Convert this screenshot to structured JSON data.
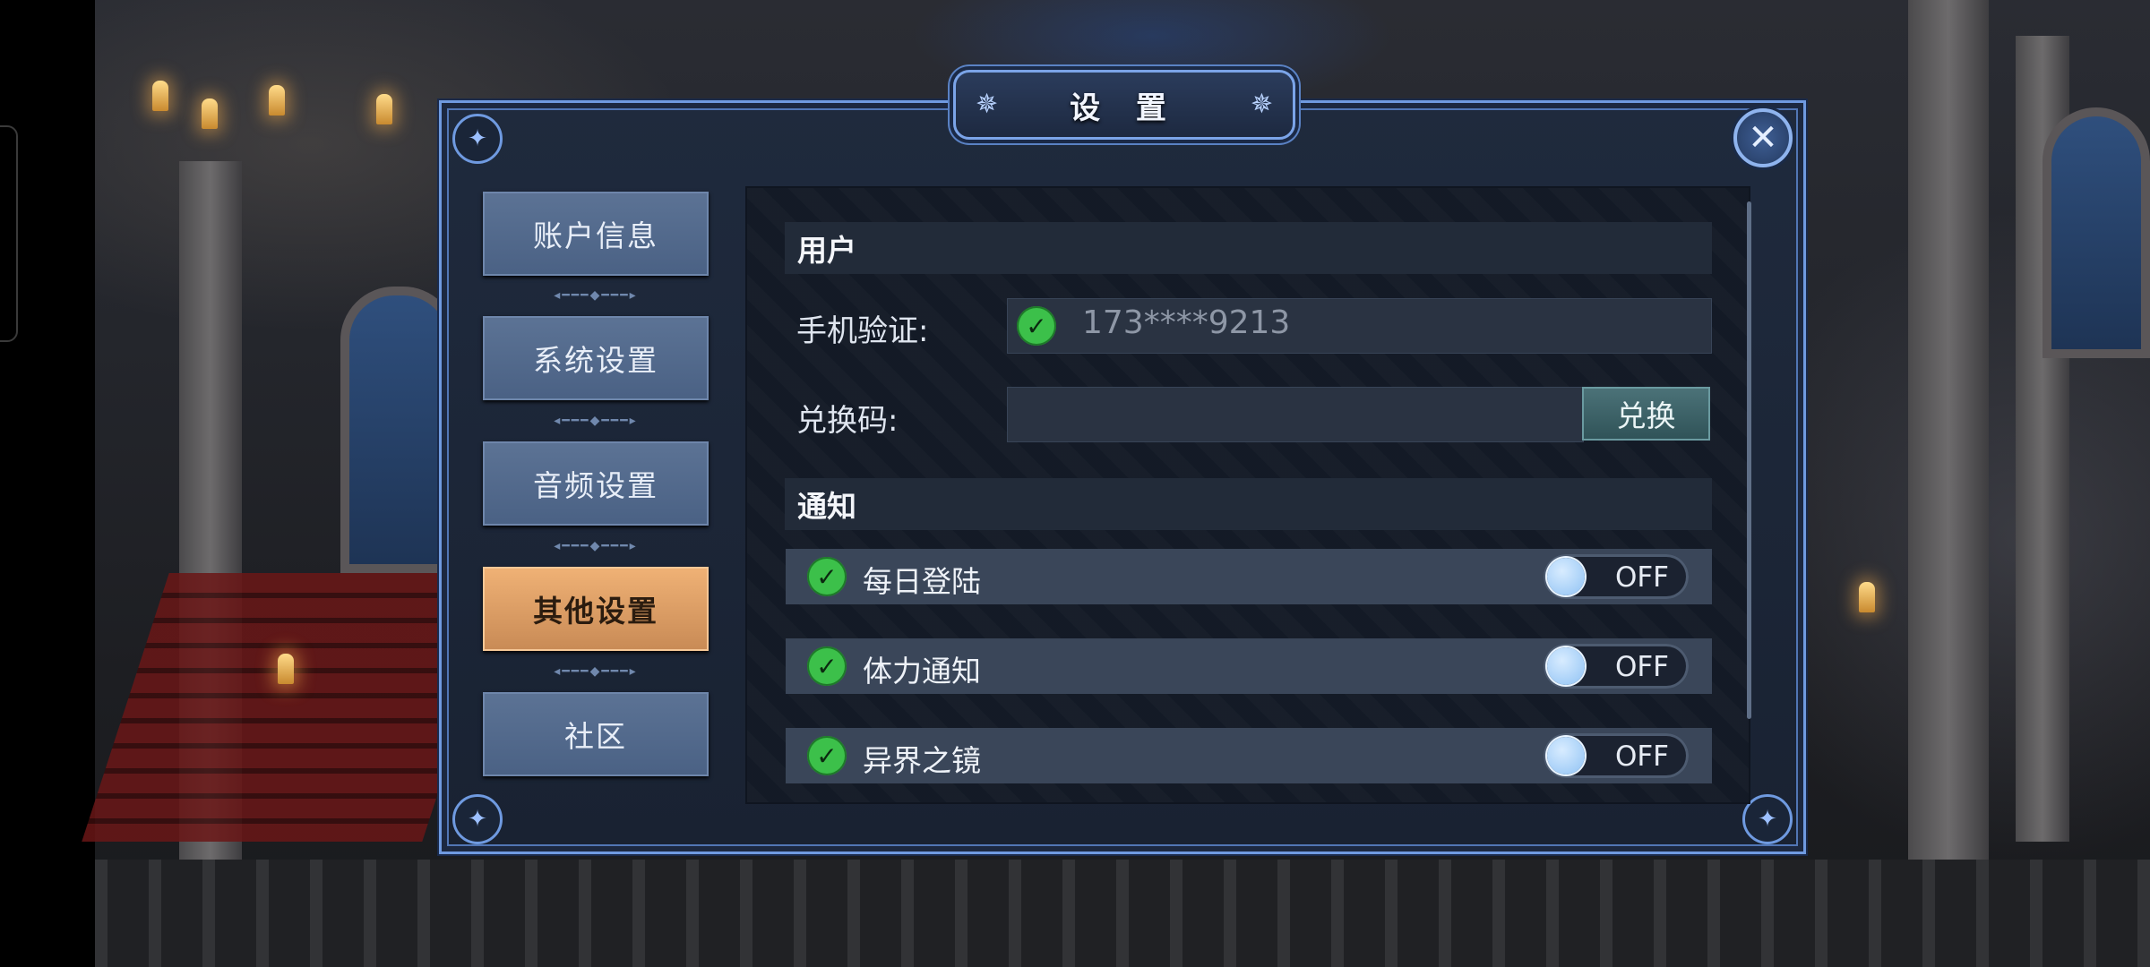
{
  "dialog": {
    "title": "设 置",
    "close_icon": "close-x-icon"
  },
  "nav": {
    "items": [
      {
        "label": "账户信息",
        "active": false
      },
      {
        "label": "系统设置",
        "active": false
      },
      {
        "label": "音频设置",
        "active": false
      },
      {
        "label": "其他设置",
        "active": true
      },
      {
        "label": "社区",
        "active": false
      }
    ]
  },
  "user_section": {
    "heading": "用户",
    "phone_label": "手机验证:",
    "phone_value": "173****9213",
    "phone_verified_icon": "check-circle-icon",
    "code_label": "兑换码:",
    "code_value": "",
    "redeem_label": "兑换"
  },
  "notify_section": {
    "heading": "通知",
    "items": [
      {
        "label": "每日登陆",
        "state": "OFF"
      },
      {
        "label": "体力通知",
        "state": "OFF"
      },
      {
        "label": "异界之镜",
        "state": "OFF"
      }
    ]
  },
  "colors": {
    "accent_blue": "#6f9ae0",
    "active_tab": "#e0a06a",
    "check_green": "#3cc04a",
    "toggle_knob": "#8fc2f4"
  }
}
